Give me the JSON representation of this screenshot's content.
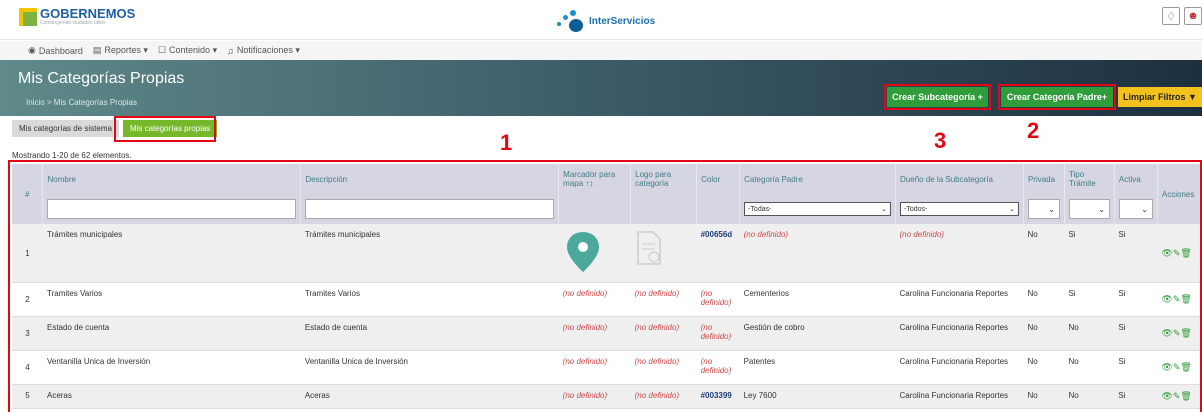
{
  "brand": {
    "name": "GOBERNEMOS",
    "tagline": "Construyendo ciudades útiles",
    "partner": "InterServicios"
  },
  "nav": [
    {
      "icon": "dashboard-icon",
      "label": "Dashboard"
    },
    {
      "icon": "reports-icon",
      "label": "Reportes ▾"
    },
    {
      "icon": "content-icon",
      "label": "Contenido ▾"
    },
    {
      "icon": "bell-icon",
      "label": "Notificaciones ▾"
    }
  ],
  "header": {
    "title": "Mis Categorías Propias",
    "breadcrumb": "Inicio  >  Mis Categorías Propias",
    "buttons": {
      "sub": "Crear Subcategoría +",
      "parent": "Crear Categoría Padre+",
      "clear": "Limpiar Filtros ▼"
    }
  },
  "tabs": {
    "system": "Mis categorías de sistema",
    "own": "Mis categorías propias"
  },
  "count_text": "Mostrando 1-20 de 62 elementos.",
  "annotations": {
    "a1": "1",
    "a2": "2",
    "a3": "3"
  },
  "columns": {
    "num": "#",
    "nombre": "Nombre",
    "desc": "Descripción",
    "marker": "Marcador para mapa ↑↕",
    "logo": "Logo para categoría",
    "color": "Color",
    "parent": "Categoría Padre",
    "owner": "Dueño de la Subcategoría",
    "private": "Privada",
    "type": "Tipo Trámite",
    "active": "Activa",
    "actions": "Acciones"
  },
  "filters": {
    "all": "-Todas-",
    "all_m": "-Todos-"
  },
  "rows": [
    {
      "n": "1",
      "nombre": "Trámites municipales",
      "desc": "Trámites municipales",
      "marker": "",
      "logo": "",
      "color": "#00656d",
      "parent": "(no definido)",
      "owner": "(no definido)",
      "priv": "No",
      "tipo": "Si",
      "act": "Si"
    },
    {
      "n": "2",
      "nombre": "Tramites Varios",
      "desc": "Tramites Varios",
      "marker": "(no definido)",
      "logo": "(no definido)",
      "color": "(no definido)",
      "parent": "Cementerios",
      "owner": "Carolina Funcionaria Reportes",
      "priv": "No",
      "tipo": "Si",
      "act": "Si"
    },
    {
      "n": "3",
      "nombre": "Estado de cuenta",
      "desc": "Estado de cuenta",
      "marker": "(no definido)",
      "logo": "(no definido)",
      "color": "(no definido)",
      "parent": "Gestión de cobro",
      "owner": "Carolina Funcionaria Reportes",
      "priv": "No",
      "tipo": "No",
      "act": "Si"
    },
    {
      "n": "4",
      "nombre": "Ventanilla Unica de Inversión",
      "desc": "Ventanilla Unica de Inversión",
      "marker": "(no definido)",
      "logo": "(no definido)",
      "color": "(no definido)",
      "parent": "Patentes",
      "owner": "Carolina Funcionaria Reportes",
      "priv": "No",
      "tipo": "No",
      "act": "Si"
    },
    {
      "n": "5",
      "nombre": "Aceras",
      "desc": "Aceras",
      "marker": "(no definido)",
      "logo": "(no definido)",
      "color": "#003399",
      "parent": "Ley 7600",
      "owner": "Carolina Funcionaria Reportes",
      "priv": "No",
      "tipo": "No",
      "act": "Si"
    }
  ],
  "action_icons": "👁✎🗑",
  "colors": {
    "accent": "#2e9d3a",
    "warn": "#f4c21c",
    "annot": "#e30613",
    "marker": "#4aa99a"
  }
}
